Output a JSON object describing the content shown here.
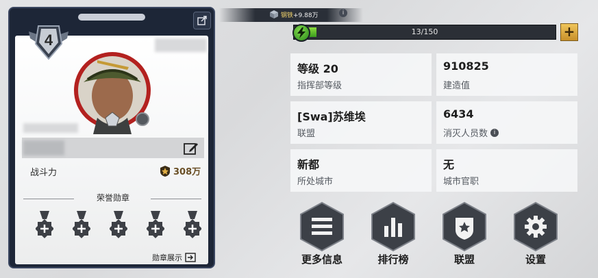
{
  "profile": {
    "rank_level": "4",
    "power_label": "战斗力",
    "power_value": "308万",
    "honor_medals_title": "荣誉勋章",
    "medal_display_link": "勋章展示",
    "medals_count_slots": 5
  },
  "resource": {
    "label": "钢铁",
    "bonus": "+9.88万"
  },
  "progress": {
    "text": "13/150",
    "current": 13,
    "max": 150
  },
  "stats": [
    {
      "value": "等级 20",
      "label": "指挥部等级"
    },
    {
      "value": "910825",
      "label": "建造值"
    },
    {
      "value": "[Swa]苏维埃",
      "label": "联盟"
    },
    {
      "value": "6434",
      "label": "消灭人员数",
      "info": "i"
    },
    {
      "value": "新都",
      "label": "所处城市"
    },
    {
      "value": "无",
      "label": "城市官职"
    }
  ],
  "actions": [
    {
      "label": "更多信息",
      "icon": "list-icon"
    },
    {
      "label": "排行榜",
      "icon": "bar-chart-icon"
    },
    {
      "label": "联盟",
      "icon": "alliance-shield-icon"
    },
    {
      "label": "设置",
      "icon": "gear-icon"
    }
  ],
  "colors": {
    "card_frame": "#1d2637",
    "progress_fill": "#5fbf2c",
    "accent_gold": "#e0ad44"
  }
}
